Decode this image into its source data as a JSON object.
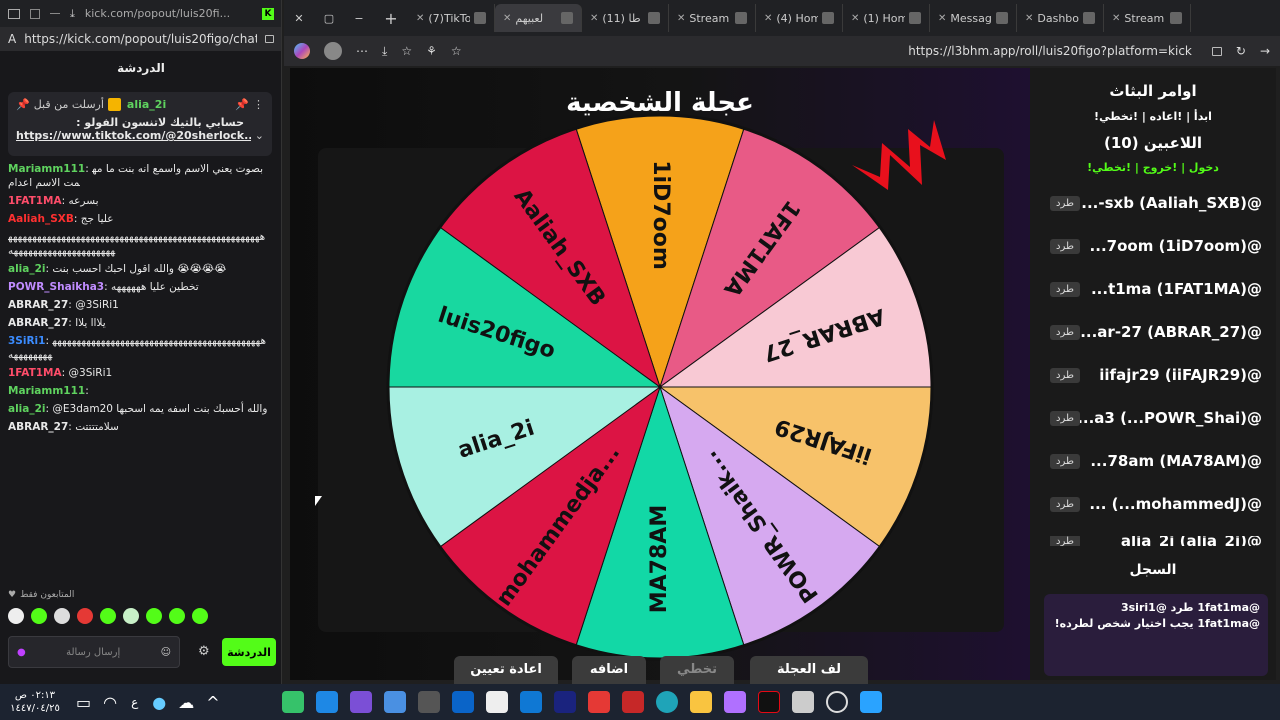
{
  "left_window": {
    "tab_title": "kick.com/popout/luis20fi...",
    "url": "https://kick.com/popout/luis20figo/chat",
    "chat_header": "الدردشة",
    "pinned": {
      "meta": "أرسلت من قبل",
      "user": "alia_2i",
      "text": "حسابي بالتيك لاتنسون الفولو :",
      "link": "https://www.tiktok.com/@20sherlock..."
    },
    "messages": [
      {
        "user": "Mariamm111",
        "color": "#5fd35f",
        "text": "بصوت يعني الاسم واسمع انه بنت ما مهمت الاسم اعدام"
      },
      {
        "user": "1FAT1MA",
        "color": "#ff4d6a",
        "text": "بسرعه"
      },
      {
        "user": "Aaliah_SXB",
        "color": "#ff3030",
        "text": "عليا جج"
      },
      {
        "user": "",
        "color": "#e8e8e8",
        "text": "ههههههههههههههههههههههههههههههههههههههههههههههههههههههههههههههههههههههههههه"
      },
      {
        "user": "alia_2i",
        "color": "#5fd35f",
        "text": "والله اقول احبك احسب بنت 😭😭😭😭"
      },
      {
        "user": "POWR_Shaikha3",
        "color": "#c08cff",
        "text": "تخطين عليا ههههههه"
      },
      {
        "user": "ABRAR_27",
        "color": "#e8e8e8",
        "text": "@3SiRi1"
      },
      {
        "user": "ABRAR_27",
        "color": "#e8e8e8",
        "text": "يلااا يلاا"
      },
      {
        "user": "3SiRi1",
        "color": "#3b8cff",
        "text": "ههههههههههههههههههههههههههههههههههههههههههههههههههههه"
      },
      {
        "user": "1FAT1MA",
        "color": "#ff4d6a",
        "text": "@3SiRi1"
      },
      {
        "user": "Mariamm111",
        "color": "#5fd35f",
        "text": ""
      },
      {
        "user": "alia_2i",
        "color": "#5fd35f",
        "text": "@E3dam20 والله أحسبك بنت اسفه يمه اسحبها"
      },
      {
        "user": "ABRAR_27",
        "color": "#e8e8e8",
        "text": "سلامتتتتت"
      }
    ],
    "followers_only": "المتابعون فقط",
    "input_placeholder": "إرسال رسالة",
    "chat_button": "الدردشة"
  },
  "browser": {
    "tabs": [
      "(7)TikTo",
      "لعبيهم",
      "(11) طا",
      "Stream",
      "(4) Hom",
      "(1) Hom",
      "Messag",
      "Dashbo",
      "Stream"
    ],
    "active_tab": 1,
    "url": "https://l3bhm.app/roll/luis20figo?platform=kick"
  },
  "page": {
    "wheel_title": "عجلة الشخصية",
    "wheel_segments": [
      {
        "name": "1iD7oom",
        "color": "#f5a21a"
      },
      {
        "name": "1FAT1MA",
        "color": "#e85a86"
      },
      {
        "name": "ABRAR_27",
        "color": "#f8c9d4"
      },
      {
        "name": "iiFAJR29",
        "color": "#f7c26a"
      },
      {
        "name": "POWR_Shaik...",
        "color": "#d6a9f0"
      },
      {
        "name": "MA78AM",
        "color": "#12d8a6"
      },
      {
        "name": "mohammedja...",
        "color": "#dc1444"
      },
      {
        "name": "alia_2i",
        "color": "#a8f0e2"
      },
      {
        "name": "luis20figo",
        "color": "#18d8a0"
      },
      {
        "name": "Aaliah_SXB",
        "color": "#dc1444"
      }
    ],
    "commands_title": "اوامر البثاث",
    "commands_line": "!ابدأ | !اعاده | !تخطي",
    "players_title": "اللاعبين (10)",
    "join_line": "!دخول | !خروج | !تخطي",
    "kick_label": "طرد",
    "players": [
      "@(Aaliah_SXB) sxb-...",
      "@(1iD7oom) 7oom...",
      "@(1FAT1MA) t1ma...",
      "@(ABRAR_27) ar-27...",
      "@(iiFAJR29) iifajr29",
      "@(POWR_Shai...) a3...",
      "@(MA78AM) 78am...",
      "@(mohammedJ...) ...",
      "@(alia_2i) alia_2i"
    ],
    "log_title": "السجل",
    "log_lines": [
      "@1fat1ma طرد @3siri1",
      "@1fat1ma يجب اختيار شخص لطرده!"
    ],
    "buttons": {
      "reset": "اعادة تعيين",
      "add": "اضافه",
      "skip": "تخطي",
      "spin": "لف العجلة"
    }
  },
  "taskbar": {
    "time": "٠٢:١٣ ص",
    "date": "١٤٤٧/٠٤/٢٥",
    "lang": "ع"
  }
}
